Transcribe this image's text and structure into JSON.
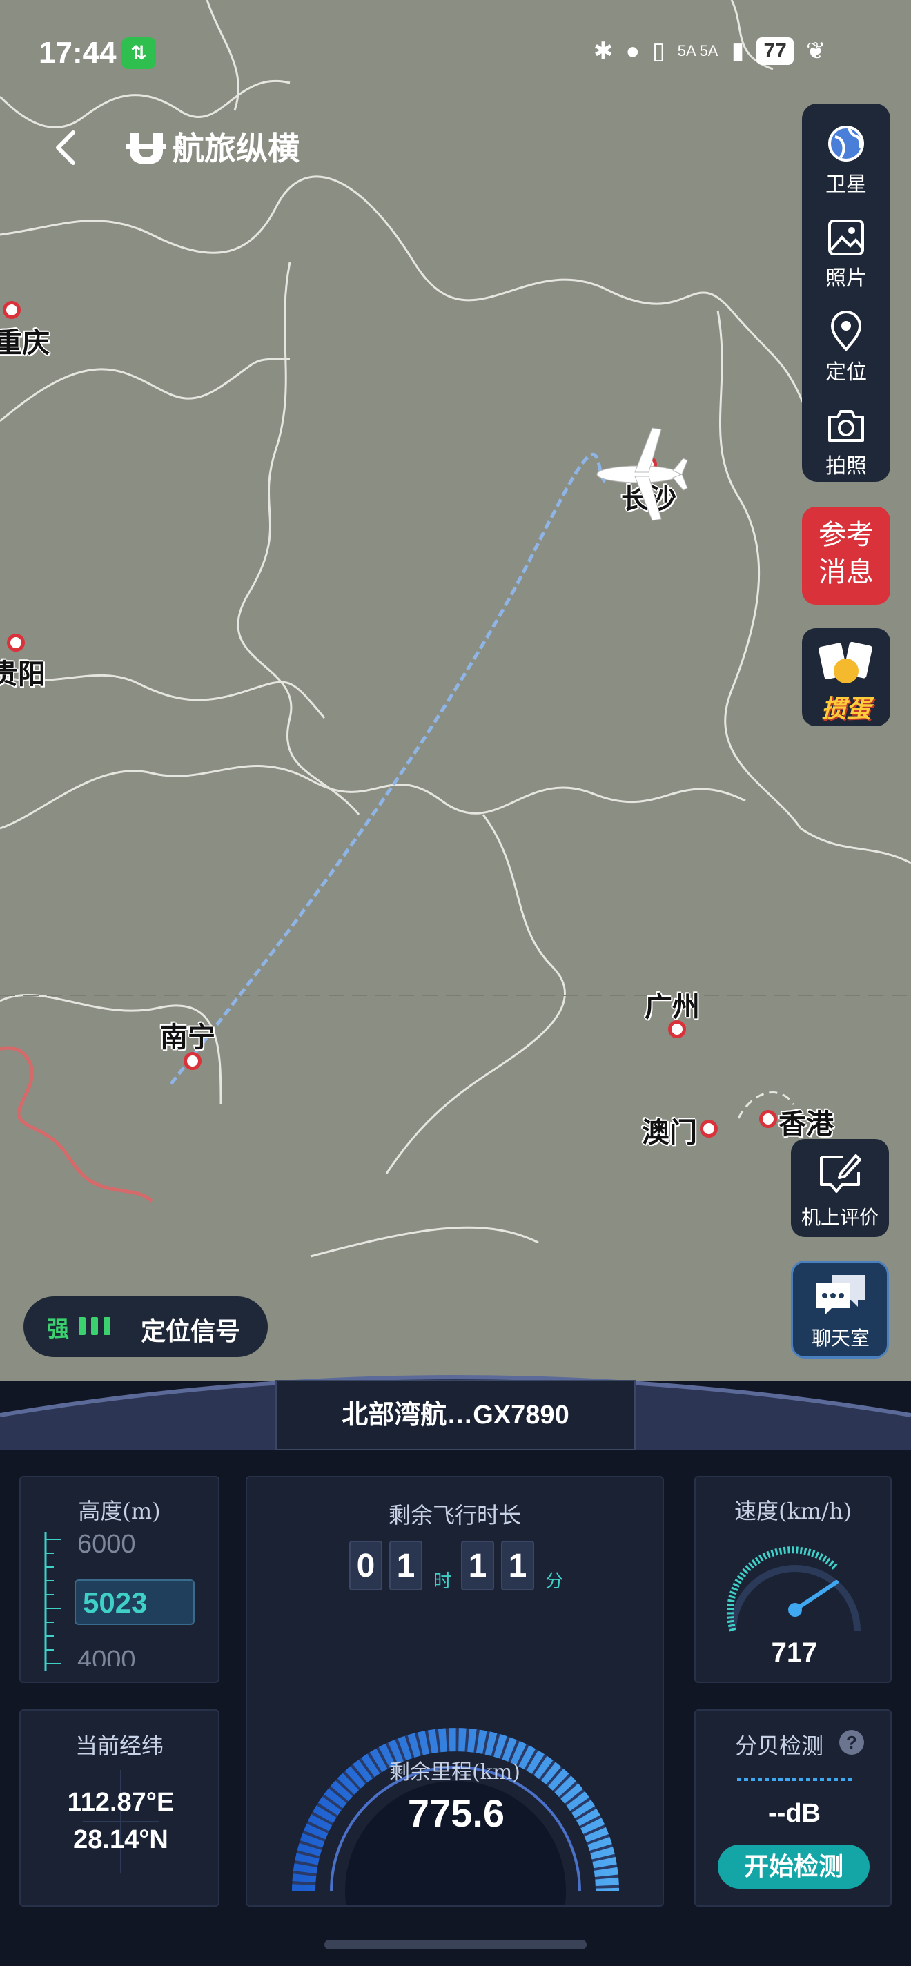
{
  "status_bar": {
    "time": "17:44",
    "net_badge": "⇅",
    "signal_text": "5A 5A",
    "battery": "77"
  },
  "header": {
    "logo_text": "航旅纵横"
  },
  "side_menu": {
    "items": [
      {
        "label": "卫星",
        "icon": "globe-icon"
      },
      {
        "label": "照片",
        "icon": "photo-icon"
      },
      {
        "label": "定位",
        "icon": "location-pin-icon"
      },
      {
        "label": "拍照",
        "icon": "camera-icon"
      }
    ]
  },
  "promos": {
    "news_label": "参考消息",
    "game_label": "掼蛋"
  },
  "map": {
    "cities": [
      {
        "name": "重庆"
      },
      {
        "name": "贵阳"
      },
      {
        "name": "长沙"
      },
      {
        "name": "南宁"
      },
      {
        "name": "广州"
      },
      {
        "name": "澳门"
      },
      {
        "name": "香港"
      }
    ]
  },
  "floating": {
    "rate_label": "机上评价",
    "chat_label": "聊天室"
  },
  "signal": {
    "strength": "强",
    "label": "定位信号"
  },
  "dashboard": {
    "flight_name": "北部湾航…GX7890",
    "altitude": {
      "title": "高度(m)",
      "ticks": [
        "6000",
        "4000"
      ],
      "value": "5023"
    },
    "remaining_time": {
      "title": "剩余飞行时长",
      "hours": [
        "0",
        "1"
      ],
      "hour_unit": "时",
      "minutes": [
        "1",
        "1"
      ],
      "minute_unit": "分"
    },
    "remaining_distance": {
      "title": "剩余里程(km)",
      "value": "775.6"
    },
    "speed": {
      "title": "速度(km/h)",
      "value": "717"
    },
    "coordinates": {
      "title": "当前经纬",
      "lon": "112.87°E",
      "lat": "28.14°N"
    },
    "decibel": {
      "title": "分贝检测",
      "value": "--dB",
      "button": "开始检测"
    }
  },
  "colors": {
    "map_bg": "#8b8e83",
    "panel_bg": "#1f2838",
    "accent_teal": "#14a6a6",
    "route_blue": "#8fb4e6",
    "promo_red": "#d9323b"
  }
}
